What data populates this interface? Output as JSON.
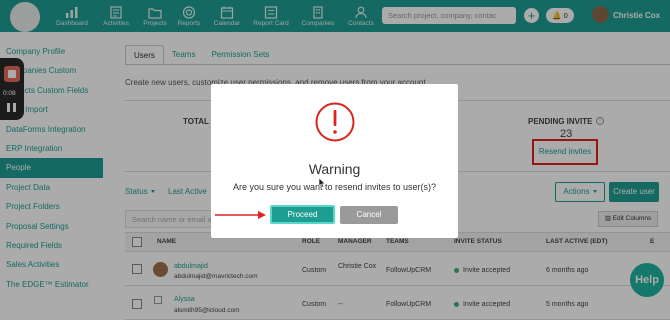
{
  "header": {
    "nav": [
      {
        "label": "Dashboard",
        "icon": "chart-icon"
      },
      {
        "label": "Activities",
        "icon": "activities-icon"
      },
      {
        "label": "Projects",
        "icon": "folder-icon"
      },
      {
        "label": "Reports",
        "icon": "reports-icon"
      },
      {
        "label": "Calendar",
        "icon": "calendar-icon"
      },
      {
        "label": "Report Card",
        "icon": "report-card-icon"
      },
      {
        "label": "Companies",
        "icon": "building-icon"
      },
      {
        "label": "Contacts",
        "icon": "contacts-icon"
      }
    ],
    "search_placeholder": "Search project, company, contac",
    "add_label": "+",
    "notifications": "0",
    "user_name": "Christie Cox"
  },
  "recorder": {
    "time": "0:08"
  },
  "sidebar": {
    "items": [
      {
        "label": "Company Profile"
      },
      {
        "label": "Companies Custom"
      },
      {
        "label": "Projects Custom Fields"
      },
      {
        "label": "Data Import"
      },
      {
        "label": "DataForms Integration"
      },
      {
        "label": "ERP Integration"
      },
      {
        "label": "People"
      },
      {
        "label": "Project Data"
      },
      {
        "label": "Project Folders"
      },
      {
        "label": "Proposal Settings"
      },
      {
        "label": "Required Fields"
      },
      {
        "label": "Sales Activities"
      },
      {
        "label": "The EDGE™ Estimator"
      }
    ],
    "active_index": 6
  },
  "tabs": [
    {
      "label": "Users"
    },
    {
      "label": "Teams"
    },
    {
      "label": "Permission Sets"
    }
  ],
  "description": "Create new users, customize user permissions, and remove users from your account.",
  "stats": {
    "total_label": "TOTAL U",
    "pending_label": "PENDING INVITE",
    "pending_count": "23",
    "resend_label": "Resend invites"
  },
  "filters": {
    "status": "Status",
    "last_active": "Last Active"
  },
  "actions_label": "Actions",
  "create_user_label": "Create user",
  "table_search_placeholder": "Search name or email a",
  "edit_columns_label": "Edit Columns",
  "table": {
    "columns": [
      "NAME",
      "ROLE",
      "MANAGER",
      "TEAMS",
      "INVITE STATUS",
      "LAST ACTIVE (EDT)",
      "E"
    ],
    "rows": [
      {
        "name": "abdulmajid",
        "email": "abdulmajid@mavrictech.com",
        "role": "Custom",
        "manager": "Christie Cox",
        "teams": "FollowUpCRM",
        "status": "Invite accepted",
        "last_active": "6 months ago"
      },
      {
        "name": "Alyssa",
        "email": "alsmith95@icloud.com",
        "role": "Custom",
        "manager": "--",
        "teams": "FollowUpCRM",
        "status": "Invite accepted",
        "last_active": "5 months ago"
      }
    ]
  },
  "help_label": "Help",
  "modal": {
    "title": "Warning",
    "message": "Are you sure you want to resend invites to user(s)?",
    "proceed_label": "Proceed",
    "cancel_label": "Cancel"
  },
  "colors": {
    "brand": "#1e9e92",
    "annotation_red": "#e22020",
    "status_green": "#3bb273"
  }
}
